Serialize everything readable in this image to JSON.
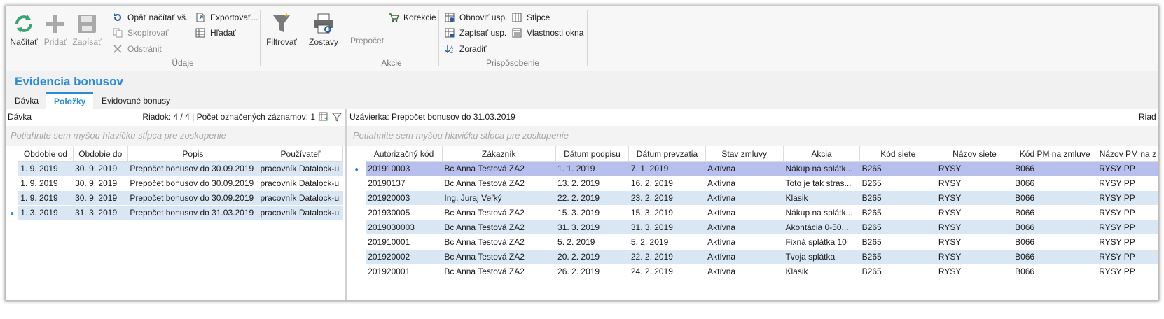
{
  "ribbon": {
    "big_buttons": {
      "reload": "Načítať",
      "add": "Pridať",
      "save": "Zapísať",
      "filter": "Filtrovať",
      "reports": "Zostavy",
      "recalc": "Prepočet"
    },
    "data_group": {
      "reload_all": "Opäť načítať vš.",
      "copy": "Skopírovať",
      "delete": "Odstrániť",
      "export": "Exportovať...",
      "find": "Hľadať",
      "label": "Údaje"
    },
    "actions_group": {
      "corrections": "Korekcie",
      "label": "Akcie"
    },
    "customize_group": {
      "restore_layout": "Obnoviť usp.",
      "save_layout": "Zapísať usp.",
      "sort": "Zoradiť",
      "columns": "Stĺpce",
      "window_props": "Vlastnosti okna",
      "label": "Prispôsobenie"
    }
  },
  "page": {
    "title": "Evidencia bonusov",
    "tabs": [
      "Dávka",
      "Položky",
      "Evidované bonusy"
    ],
    "active_tab": "Položky"
  },
  "left_pane": {
    "title": "Dávka",
    "status": "Riadok: 4 / 4 | Počet označených záznamov: 1",
    "group_hint": "Potiahnite sem myšou hlavičku stĺpca pre zoskupenie",
    "columns": [
      "Obdobie od",
      "Obdobie do",
      "Popis",
      "Používateľ"
    ],
    "rows": [
      [
        "1. 9. 2019",
        "30. 9. 2019",
        "Prepočet bonusov do 30.09.2019",
        "pracovník Datalock-u"
      ],
      [
        "1. 9. 2019",
        "30. 9. 2019",
        "Prepočet bonusov do 30.09.2019",
        "pracovník Datalock-u"
      ],
      [
        "1. 9. 2019",
        "30. 9. 2019",
        "Prepočet bonusov do 30.09.2019",
        "pracovník Datalock-u"
      ],
      [
        "1. 3. 2019",
        "31. 3. 2019",
        "Prepočet bonusov do 31.03.2019",
        "pracovník Datalock-u"
      ]
    ]
  },
  "right_pane": {
    "title": "Uzávierka: Prepočet bonusov do 31.03.2019",
    "status": "Riad",
    "group_hint": "Potiahnite sem myšou hlavičku stĺpca pre zoskupenie",
    "columns": [
      "Autorizačný kód",
      "Zákazník",
      "Dátum podpisu",
      "Dátum prevzatia",
      "Stav zmluvy",
      "Akcia",
      "Kód siete",
      "Názov siete",
      "Kód PM na zmluve",
      "Názov PM na z"
    ],
    "rows": [
      [
        "201910003",
        "Bc Anna  Testová ZA2",
        "1. 1. 2019",
        "7. 1. 2019",
        "Aktívna",
        "Nákup na splátk...",
        "B265",
        "RYSY",
        "B066",
        "RYSY PP"
      ],
      [
        "20190137",
        "Bc Anna  Testová ZA2",
        "13. 2. 2019",
        "16. 2. 2019",
        "Aktívna",
        "Toto je tak stras...",
        "B265",
        "RYSY",
        "B066",
        "RYSY PP"
      ],
      [
        "201920003",
        "Ing. Juraj Veľký",
        "22. 2. 2019",
        "23. 2. 2019",
        "Aktívna",
        "Klasik",
        "B265",
        "RYSY",
        "B066",
        "RYSY PP"
      ],
      [
        "201930005",
        "Bc Anna  Testová ZA2",
        "15. 3. 2019",
        "15. 3. 2019",
        "Aktívna",
        "Nákup na splátk...",
        "B265",
        "RYSY",
        "B066",
        "RYSY PP"
      ],
      [
        "2019030003",
        "Bc Anna  Testová ZA2",
        "31. 3. 2019",
        "31. 3. 2019",
        "Aktívna",
        "Akontácia 0-50...",
        "B265",
        "RYSY",
        "B066",
        "RYSY PP"
      ],
      [
        "201910001",
        "Bc Anna  Testová ZA2",
        "5. 2. 2019",
        "5. 2. 2019",
        "Aktívna",
        "Fixná splátka 10",
        "B265",
        "RYSY",
        "B066",
        "RYSY PP"
      ],
      [
        "201920002",
        "Bc Anna  Testová ZA2",
        "20. 2. 2019",
        "22. 2. 2019",
        "Aktívna",
        "Tvoja splátka",
        "B265",
        "RYSY",
        "B066",
        "RYSY PP"
      ],
      [
        "201920001",
        "Bc Anna  Testová ZA2",
        "26. 2. 2019",
        "24. 2. 2019",
        "Aktívna",
        "Klasik",
        "B265",
        "RYSY",
        "B066",
        "RYSY PP"
      ]
    ]
  },
  "colors": {
    "accent": "#2a8bd8",
    "row_alt": "#d9e6f3",
    "row_selected": "#b7c0ec"
  }
}
